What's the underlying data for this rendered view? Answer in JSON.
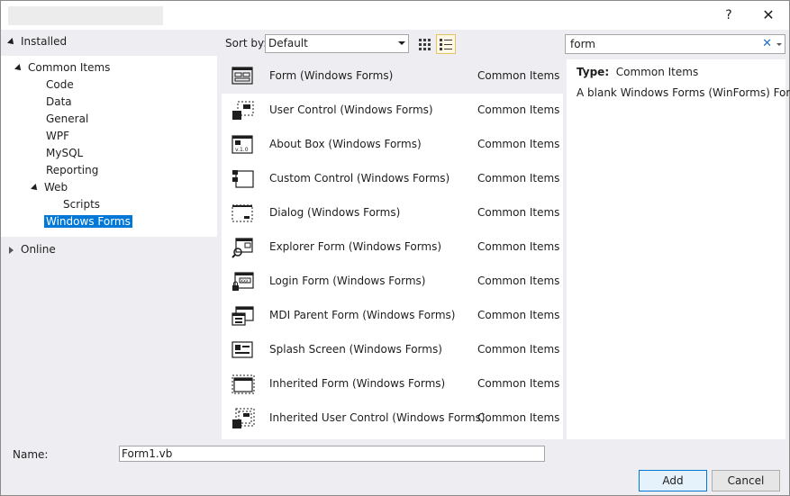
{
  "window": {
    "help": "?",
    "close": "✕"
  },
  "tree": {
    "installed": "Installed",
    "common_items": "Common Items",
    "children": [
      "Code",
      "Data",
      "General",
      "WPF",
      "MySQL",
      "Reporting",
      "Web"
    ],
    "scripts": "Scripts",
    "windows_forms": "Windows Forms",
    "online": "Online"
  },
  "toolbar": {
    "sort_label": "Sort by:",
    "sort_value": "Default"
  },
  "search": {
    "value": "form",
    "clear": "✕"
  },
  "items": [
    {
      "name": "Form (Windows Forms)",
      "category": "Common Items",
      "icon": "form-icon"
    },
    {
      "name": "User Control (Windows Forms)",
      "category": "Common Items",
      "icon": "user-control-icon"
    },
    {
      "name": "About Box (Windows Forms)",
      "category": "Common Items",
      "icon": "about-box-icon"
    },
    {
      "name": "Custom Control (Windows Forms)",
      "category": "Common Items",
      "icon": "custom-control-icon"
    },
    {
      "name": "Dialog (Windows Forms)",
      "category": "Common Items",
      "icon": "dialog-icon"
    },
    {
      "name": "Explorer Form (Windows Forms)",
      "category": "Common Items",
      "icon": "explorer-form-icon"
    },
    {
      "name": "Login Form (Windows Forms)",
      "category": "Common Items",
      "icon": "login-form-icon"
    },
    {
      "name": "MDI Parent Form (Windows Forms)",
      "category": "Common Items",
      "icon": "mdi-parent-form-icon"
    },
    {
      "name": "Splash Screen (Windows Forms)",
      "category": "Common Items",
      "icon": "splash-screen-icon"
    },
    {
      "name": "Inherited Form (Windows Forms)",
      "category": "Common Items",
      "icon": "inherited-form-icon"
    },
    {
      "name": "Inherited User Control (Windows Forms)",
      "category": "Common Items",
      "icon": "inherited-user-control-icon"
    }
  ],
  "details": {
    "type_label": "Type:",
    "type_value": "Common Items",
    "description": "A blank Windows Forms (WinForms) Form"
  },
  "footer": {
    "name_label": "Name:",
    "name_value": "Form1.vb",
    "add_label": "Add",
    "cancel_label": "Cancel"
  },
  "colors": {
    "accent": "#0078d7",
    "panel": "#eeeef2"
  }
}
